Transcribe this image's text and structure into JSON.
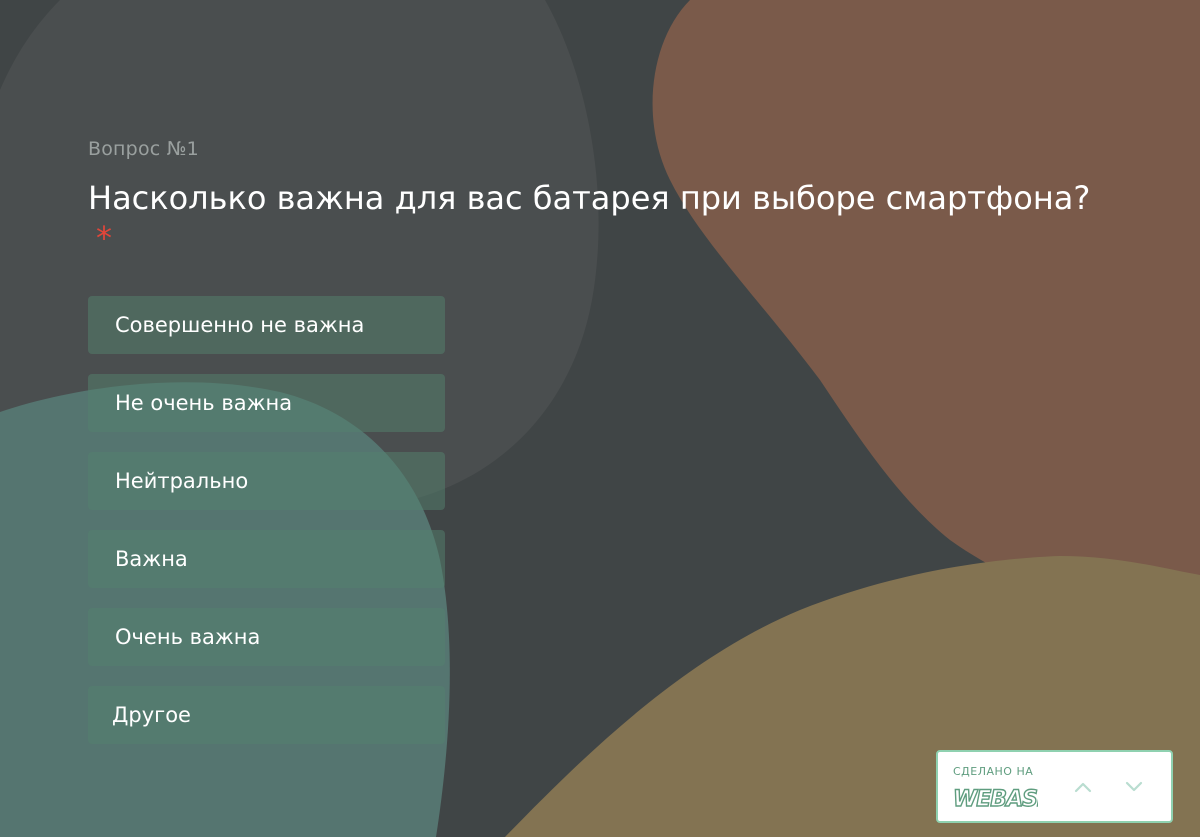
{
  "question": {
    "number_label": "Вопрос №1",
    "title": "Насколько важна для вас батарея при выборе смартфона?",
    "required_mark": "*"
  },
  "options": [
    {
      "label": "Совершенно не важна"
    },
    {
      "label": "Не очень важна"
    },
    {
      "label": "Нейтрально"
    },
    {
      "label": "Важна"
    },
    {
      "label": "Очень важна"
    },
    {
      "label": "Другое"
    }
  ],
  "badge": {
    "label": "СДЕЛАНО НА",
    "logo_text": "WEBASK",
    "up_icon": "chevron-up-icon",
    "down_icon": "chevron-down-icon"
  },
  "colors": {
    "background": "#404546",
    "accent_required": "#e0463a",
    "blob_brown": "#7a5a4a",
    "blob_olive": "#837352",
    "blob_teal": "#557570",
    "blob_gray": "#4a4e4f",
    "badge_border": "#8fd1b0"
  }
}
